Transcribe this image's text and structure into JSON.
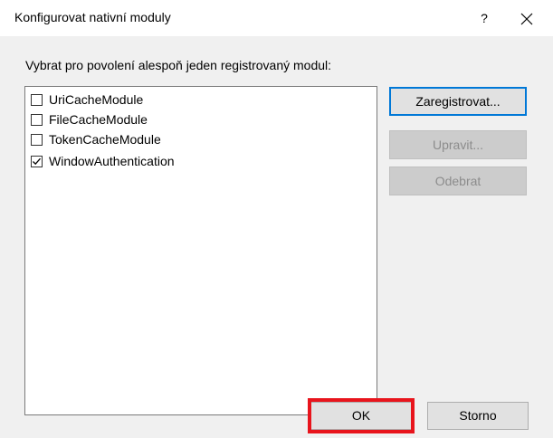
{
  "window": {
    "title": "Konfigurovat nativní moduly",
    "help_label": "?",
    "close_icon": "close-icon"
  },
  "instruction": "Vybrat pro povolení alespoň jeden registrovaný modul:",
  "modules": [
    {
      "label": "UriCacheModule",
      "checked": false
    },
    {
      "label": "FileCacheModule",
      "checked": false
    },
    {
      "label": "TokenCacheModule",
      "checked": false
    },
    {
      "label": "WindowAuthentication",
      "checked": true
    }
  ],
  "side_buttons": {
    "register": "Zaregistrovat...",
    "edit": "Upravit...",
    "remove": "Odebrat"
  },
  "footer": {
    "ok": "OK",
    "cancel": "Storno"
  },
  "colors": {
    "accent": "#0078d7",
    "highlight": "#e8141c",
    "client_bg": "#f0f0f0"
  }
}
